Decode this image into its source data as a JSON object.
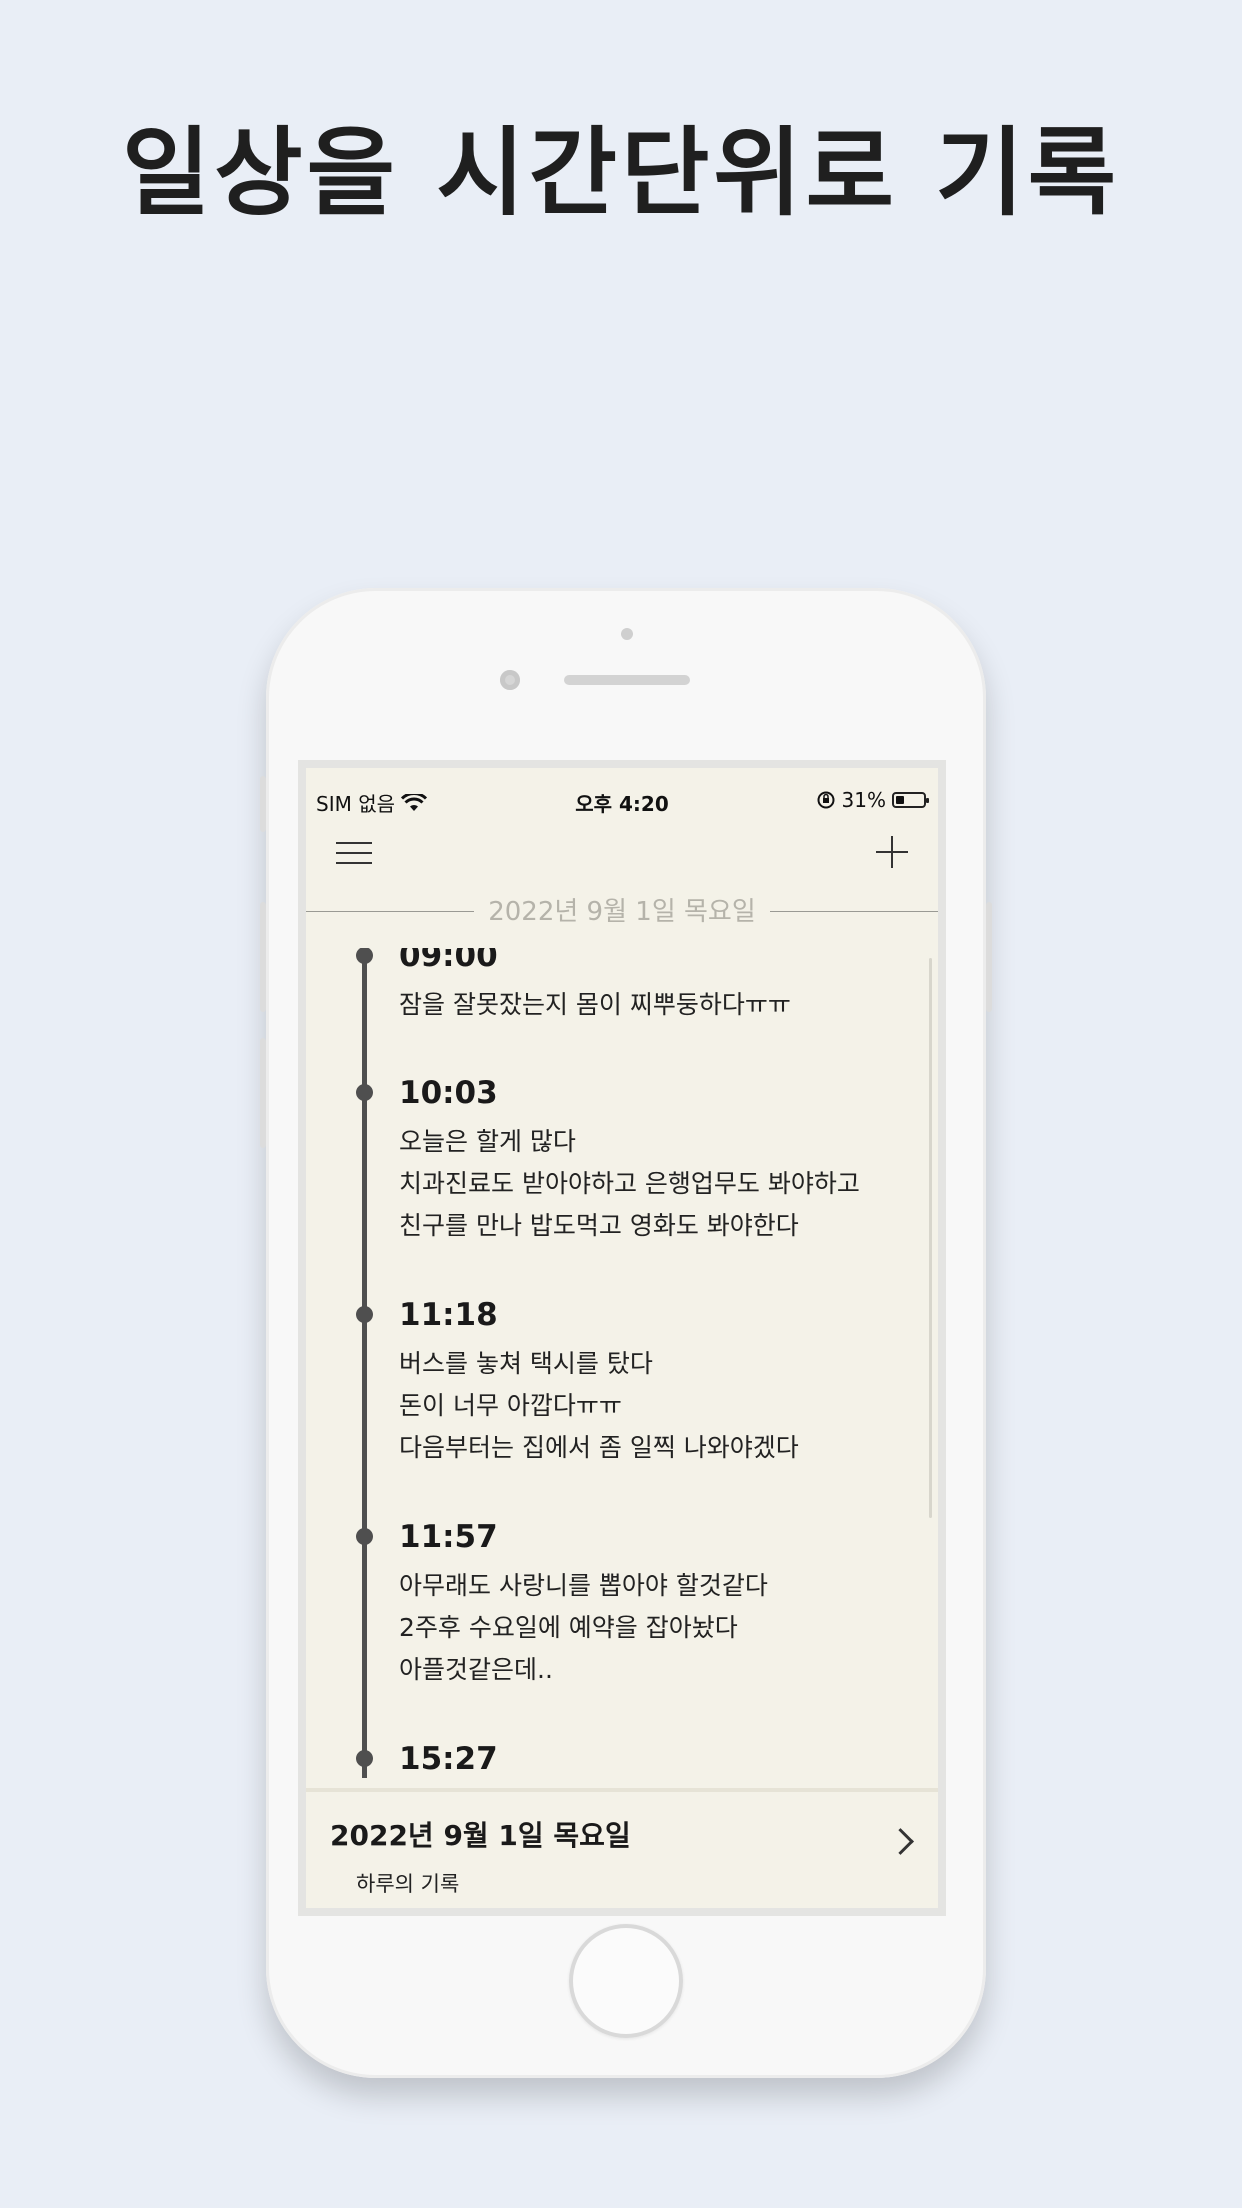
{
  "headline": "일상을 시간단위로 기록",
  "status_bar": {
    "carrier": "SIM 없음",
    "time": "오후 4:20",
    "battery": "31%",
    "battery_level": 0.31
  },
  "current_date": "2022년 9월 1일 목요일",
  "entries": [
    {
      "time": "09:00",
      "text": "잠을 잘못잤는지 몸이 찌뿌둥하다ㅠㅠ"
    },
    {
      "time": "10:03",
      "text": "오늘은 할게 많다\n치과진료도 받아야하고 은행업무도 봐야하고\n친구를 만나 밥도먹고 영화도 봐야한다"
    },
    {
      "time": "11:18",
      "text": "버스를 놓쳐 택시를 탔다\n돈이 너무 아깝다ㅠㅠ\n다음부터는 집에서 좀 일찍 나와야겠다"
    },
    {
      "time": "11:57",
      "text": "아무래도 사랑니를 뽑아야 할것같다\n2주후 수요일에 예약을 잡아놨다\n아플것같은데.."
    },
    {
      "time": "15:27",
      "text": ""
    }
  ],
  "bottom_card": {
    "title": "2022년 9월 1일 목요일",
    "subtitle": "하루의 기록"
  }
}
